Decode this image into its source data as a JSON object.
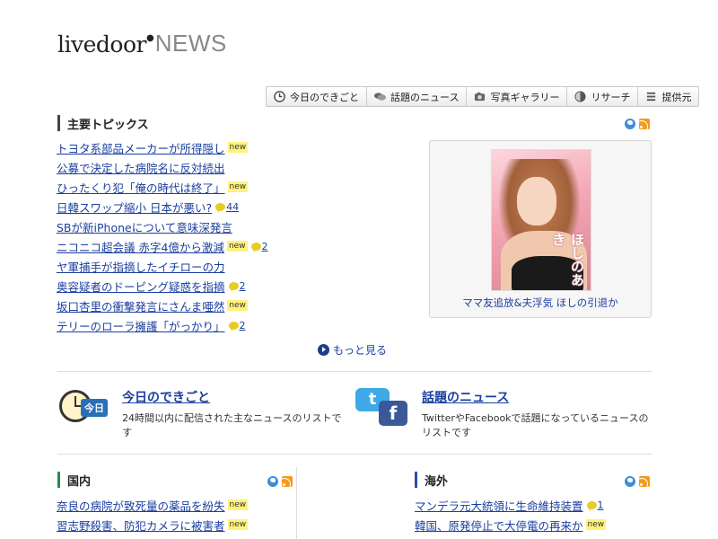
{
  "header": {
    "logo_brand": "livedoor",
    "logo_news": "NEWS"
  },
  "topnav": [
    {
      "label": "今日のできごと",
      "icon": "clock-icon"
    },
    {
      "label": "話題のニュース",
      "icon": "chat-icon"
    },
    {
      "label": "写真ギャラリー",
      "icon": "camera-icon"
    },
    {
      "label": "リサーチ",
      "icon": "pie-chart-icon"
    },
    {
      "label": "提供元",
      "icon": "list-icon"
    }
  ],
  "main_topics": {
    "title": "主要トピックス",
    "items": [
      {
        "text": "トヨタ系部品メーカーが所得隠し",
        "new": "new",
        "comments": ""
      },
      {
        "text": "公募で決定した病院名に反対続出",
        "new": "",
        "comments": ""
      },
      {
        "text": "ひったくり犯「俺の時代は終了」",
        "new": "new",
        "comments": ""
      },
      {
        "text": "日韓スワップ縮小 日本が悪い?",
        "new": "",
        "comments": "44"
      },
      {
        "text": "SBが新iPhoneについて意味深発言",
        "new": "",
        "comments": ""
      },
      {
        "text": "ニコニコ超会議 赤字4億から激減",
        "new": "new",
        "comments": "2"
      },
      {
        "text": "ヤ軍捕手が指摘したイチローの力",
        "new": "",
        "comments": ""
      },
      {
        "text": "奥容疑者のドーピング疑惑を指摘",
        "new": "",
        "comments": "2"
      },
      {
        "text": "坂口杏里の衝撃発言にさんま唖然",
        "new": "new",
        "comments": ""
      },
      {
        "text": "テリーのローラ擁護「がっかり」",
        "new": "",
        "comments": "2"
      }
    ],
    "more_label": "もっと見る"
  },
  "featured": {
    "image_text": "ほしのあき",
    "caption": "ママ友追放&夫浮気 ほしの引退か"
  },
  "promos": [
    {
      "title": "今日のできごと",
      "desc": "24時間以内に配信された主なニュースのリストです",
      "badge": "今日"
    },
    {
      "title": "話題のニュース",
      "desc": "TwitterやFacebookで話題になっているニュースのリストです",
      "tw": "t",
      "fb": "f"
    }
  ],
  "domestic": {
    "title": "国内",
    "items": [
      {
        "text": "奈良の病院が致死量の薬品を紛失",
        "new": "new",
        "comments": ""
      },
      {
        "text": "習志野殺害、防犯カメラに被害者",
        "new": "new",
        "comments": ""
      }
    ]
  },
  "overseas": {
    "title": "海外",
    "items": [
      {
        "text": "マンデラ元大統領に生命維持装置",
        "new": "",
        "comments": "1"
      },
      {
        "text": "韓国、原発停止で大停電の再来か",
        "new": "new",
        "comments": ""
      }
    ]
  }
}
